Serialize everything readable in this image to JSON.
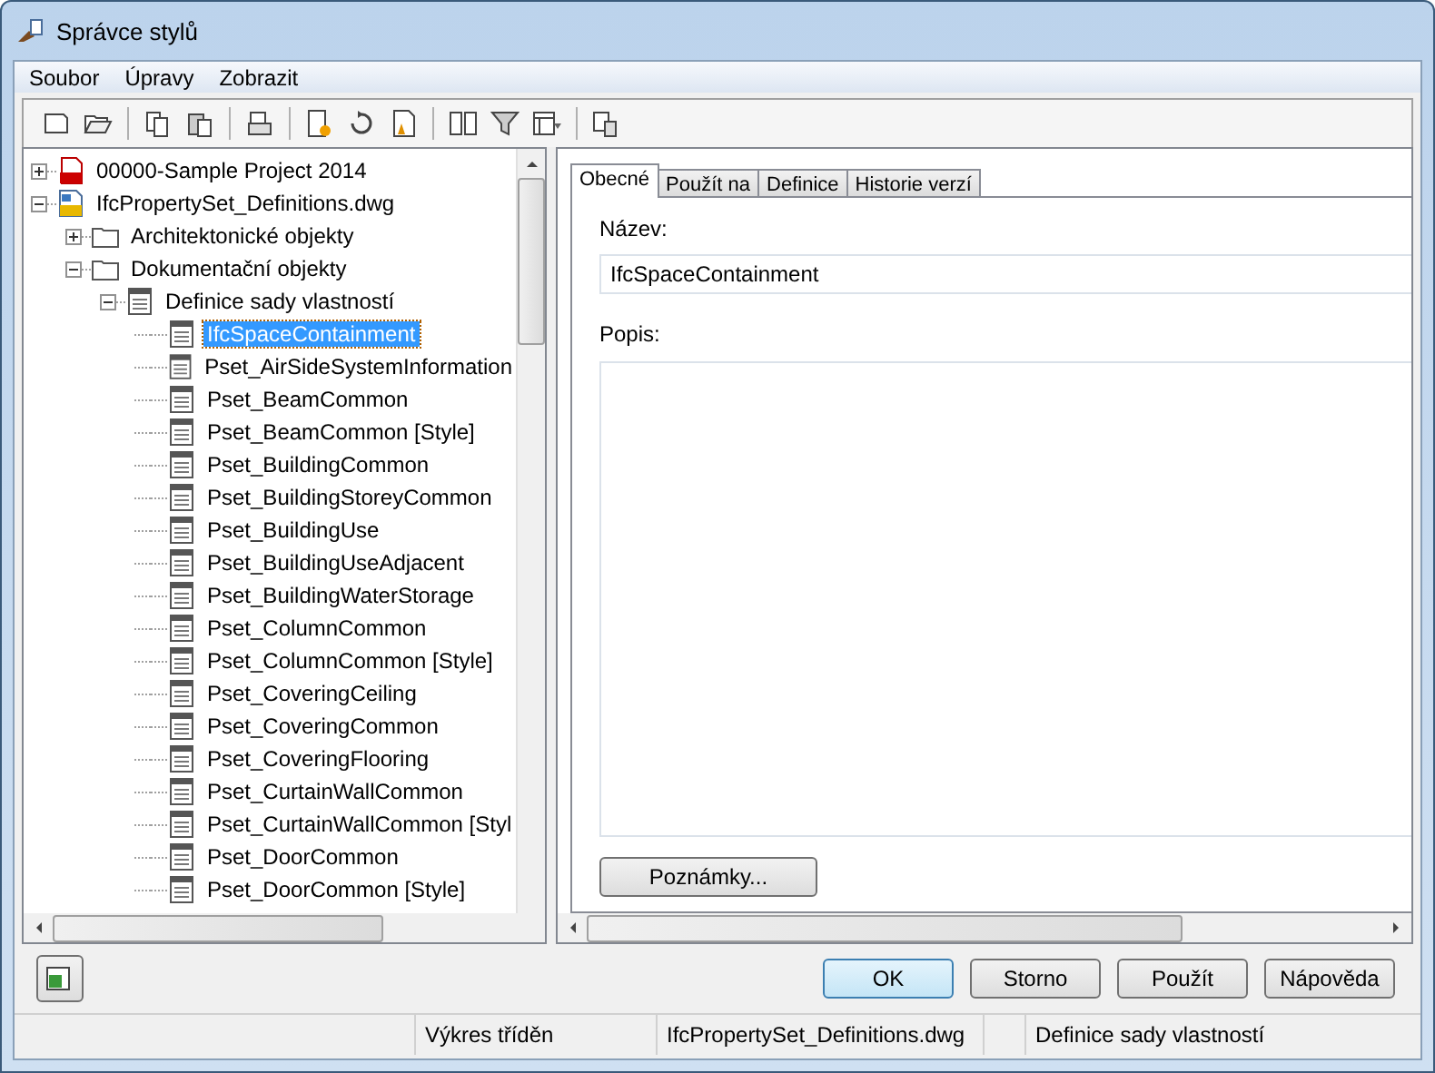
{
  "window": {
    "title": "Správce stylů"
  },
  "menu": [
    {
      "label": "Soubor"
    },
    {
      "label": "Úpravy"
    },
    {
      "label": "Zobrazit"
    }
  ],
  "tree": [
    {
      "label": "00000-Sample Project 2014",
      "kind": "project",
      "expanded": false,
      "selected": false
    },
    {
      "label": "IfcPropertySet_Definitions.dwg",
      "kind": "drawing",
      "expanded": true,
      "selected": false,
      "children": [
        {
          "label": "Architektonické objekty",
          "kind": "folder",
          "expanded": false,
          "selected": false
        },
        {
          "label": "Dokumentační objekty",
          "kind": "folder",
          "expanded": true,
          "selected": false,
          "children": [
            {
              "label": "Definice sady vlastností",
              "kind": "category",
              "expanded": true,
              "selected": false,
              "children": [
                {
                  "label": "IfcSpaceContainment",
                  "kind": "style",
                  "selected": true
                },
                {
                  "label": "Pset_AirSideSystemInformation",
                  "kind": "style",
                  "selected": false
                },
                {
                  "label": "Pset_BeamCommon",
                  "kind": "style",
                  "selected": false
                },
                {
                  "label": "Pset_BeamCommon [Style]",
                  "kind": "style",
                  "selected": false
                },
                {
                  "label": "Pset_BuildingCommon",
                  "kind": "style",
                  "selected": false
                },
                {
                  "label": "Pset_BuildingStoreyCommon",
                  "kind": "style",
                  "selected": false
                },
                {
                  "label": "Pset_BuildingUse",
                  "kind": "style",
                  "selected": false
                },
                {
                  "label": "Pset_BuildingUseAdjacent",
                  "kind": "style",
                  "selected": false
                },
                {
                  "label": "Pset_BuildingWaterStorage",
                  "kind": "style",
                  "selected": false
                },
                {
                  "label": "Pset_ColumnCommon",
                  "kind": "style",
                  "selected": false
                },
                {
                  "label": "Pset_ColumnCommon [Style]",
                  "kind": "style",
                  "selected": false
                },
                {
                  "label": "Pset_CoveringCeiling",
                  "kind": "style",
                  "selected": false
                },
                {
                  "label": "Pset_CoveringCommon",
                  "kind": "style",
                  "selected": false
                },
                {
                  "label": "Pset_CoveringFlooring",
                  "kind": "style",
                  "selected": false
                },
                {
                  "label": "Pset_CurtainWallCommon",
                  "kind": "style",
                  "selected": false
                },
                {
                  "label": "Pset_CurtainWallCommon [Styl",
                  "kind": "style",
                  "selected": false
                },
                {
                  "label": "Pset_DoorCommon",
                  "kind": "style",
                  "selected": false
                },
                {
                  "label": "Pset_DoorCommon [Style]",
                  "kind": "style",
                  "selected": false
                }
              ]
            }
          ]
        }
      ]
    }
  ],
  "tabs": [
    {
      "label": "Obecné",
      "selected": true
    },
    {
      "label": "Použít na",
      "selected": false
    },
    {
      "label": "Definice",
      "selected": false
    },
    {
      "label": "Historie verzí",
      "selected": false
    }
  ],
  "form": {
    "name_label": "Název:",
    "name_value": "IfcSpaceContainment",
    "description_label": "Popis:",
    "notes_button": "Poznámky..."
  },
  "buttons": [
    {
      "label": "OK",
      "default": true
    },
    {
      "label": "Storno",
      "default": false
    },
    {
      "label": "Použít",
      "default": false
    },
    {
      "label": "Nápověda",
      "default": false
    }
  ],
  "status_bar": [
    "Výkres tříděn",
    "IfcPropertySet_Definitions.dwg",
    "Definice sady vlastností"
  ]
}
